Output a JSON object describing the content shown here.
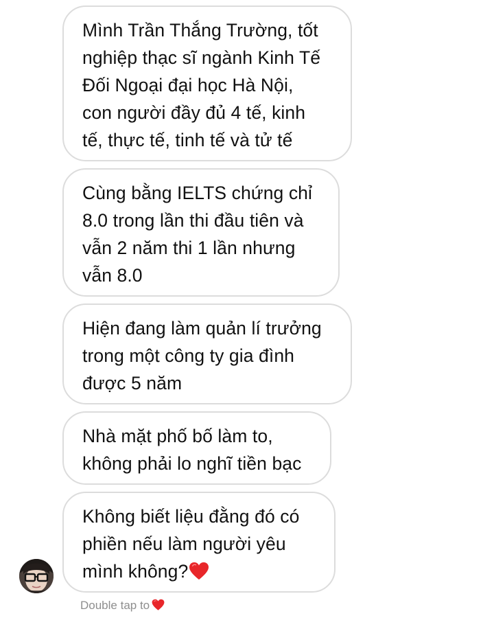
{
  "thread": {
    "messages": [
      {
        "lines": [
          "Mình Trần Thắng Trường, tốt",
          "nghiệp thạc sĩ ngành Kinh Tế",
          "Đối Ngoại đại học Hà Nội,",
          "con người đầy đủ 4 tế, kinh",
          "tế, thực tế, tinh tế và tử tế"
        ]
      },
      {
        "lines": [
          "Cùng bằng IELTS chứng chỉ",
          "8.0 trong lần thi đầu tiên và",
          "vẫn 2 năm thi 1 lần nhưng",
          "vẫn 8.0"
        ]
      },
      {
        "lines": [
          "Hiện đang làm quản lí trưởng",
          "trong một công ty gia đình",
          "được 5 năm"
        ]
      },
      {
        "lines": [
          "Nhà mặt phố bố làm to,",
          "không phải lo nghĩ tiền bạc"
        ]
      },
      {
        "lines": [
          "Không biết liệu đằng đó có",
          "phiền nếu làm người yêu",
          "mình không?"
        ],
        "trailing_emoji": "red-heart"
      }
    ],
    "sender_avatar": "avatar-photo",
    "reaction_hint": "Double tap to",
    "reaction_hint_icon": "red-heart",
    "heart_color": "#e8262a",
    "bubble_border_color": "#dcdcdc",
    "hint_color": "#8e8e8e"
  }
}
